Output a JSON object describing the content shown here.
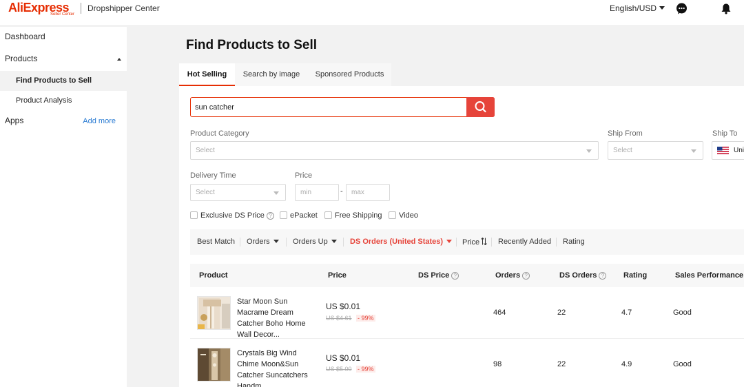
{
  "header": {
    "brand": "AliExpress",
    "brand_sub": "Seller Center",
    "title": "Dropshipper Center",
    "language": "English/USD"
  },
  "sidebar": {
    "dashboard": "Dashboard",
    "products": "Products",
    "find_products": "Find Products to Sell",
    "product_analysis": "Product Analysis",
    "apps": "Apps",
    "add_more": "Add more"
  },
  "main": {
    "title": "Find Products to Sell",
    "tabs": [
      {
        "label": "Hot Selling"
      },
      {
        "label": "Search by image"
      },
      {
        "label": "Sponsored Products"
      }
    ],
    "search": {
      "value": "sun catcher"
    },
    "filters": {
      "category_label": "Product Category",
      "category_placeholder": "Select",
      "ship_from_label": "Ship From",
      "ship_from_placeholder": "Select",
      "ship_to_label": "Ship To",
      "ship_to_value": "Uni",
      "delivery_label": "Delivery Time",
      "delivery_placeholder": "Select",
      "price_label": "Price",
      "price_min": "min",
      "price_max": "max",
      "price_dash": "-"
    },
    "checkboxes": {
      "exclusive": "Exclusive DS Price",
      "epacket": "ePacket",
      "free_shipping": "Free Shipping",
      "video": "Video"
    },
    "sort": {
      "best_match": "Best Match",
      "orders": "Orders",
      "orders_up": "Orders Up",
      "ds_orders": "DS Orders (United States)",
      "price": "Price",
      "recently_added": "Recently Added",
      "rating": "Rating"
    },
    "table": {
      "headers": {
        "product": "Product",
        "price": "Price",
        "ds_price": "DS Price",
        "orders": "Orders",
        "ds_orders": "DS Orders",
        "rating": "Rating",
        "sales_performance": "Sales Performance"
      },
      "rows": [
        {
          "name": "Star Moon Sun Macrame Dream Catcher Boho Home Wall Decor...",
          "price": "US $0.01",
          "old_price": "US $4.61",
          "discount": "- 99%",
          "orders": "464",
          "ds_orders": "22",
          "rating": "4.7",
          "performance": "Good"
        },
        {
          "name": "Crystals Big Wind Chime Moon&Sun Catcher Suncatchers Handm...",
          "price": "US $0.01",
          "old_price": "US $5.00",
          "discount": "- 99%",
          "orders": "98",
          "ds_orders": "22",
          "rating": "4.9",
          "performance": "Good"
        }
      ]
    }
  },
  "colors": {
    "brand_red": "#e62e04",
    "accent_red": "#e6443a",
    "link_blue": "#2b7cd3"
  }
}
